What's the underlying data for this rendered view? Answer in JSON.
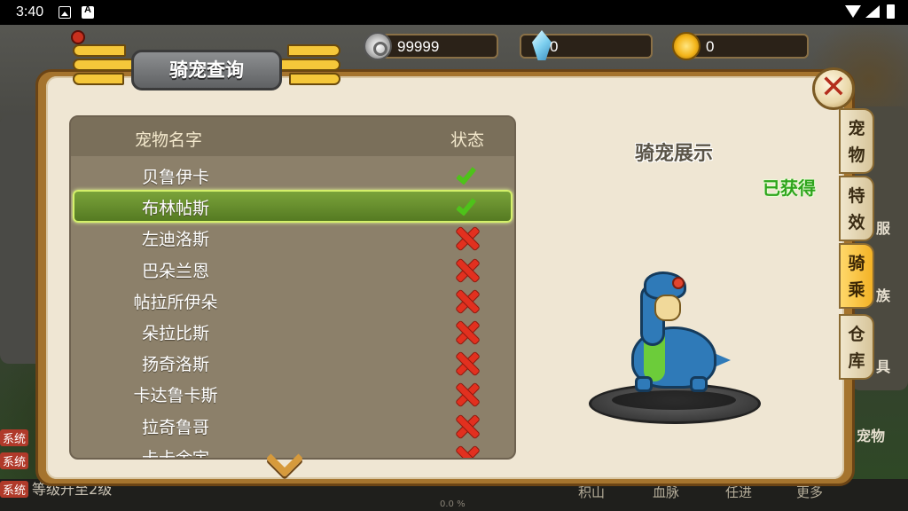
{
  "status_bar": {
    "time": "3:40"
  },
  "currency": {
    "silver": "99999",
    "crystal": "0",
    "gold": "0"
  },
  "panel": {
    "title": "骑宠查询",
    "close_glyph": "✕"
  },
  "pet_list": {
    "header_name": "宠物名字",
    "header_status": "状态",
    "rows": [
      {
        "name": "贝鲁伊卡",
        "status": "obtained"
      },
      {
        "name": "布林帖斯",
        "status": "obtained"
      },
      {
        "name": "左迪洛斯",
        "status": "locked"
      },
      {
        "name": "巴朵兰恩",
        "status": "locked"
      },
      {
        "name": "帖拉所伊朵",
        "status": "locked"
      },
      {
        "name": "朵拉比斯",
        "status": "locked"
      },
      {
        "name": "扬奇洛斯",
        "status": "locked"
      },
      {
        "name": "卡达鲁卡斯",
        "status": "locked"
      },
      {
        "name": "拉奇鲁哥",
        "status": "locked"
      },
      {
        "name": "卡卡余宇",
        "status": "locked"
      }
    ],
    "selected_index": 1
  },
  "display": {
    "title": "骑宠展示",
    "obtained_label": "已获得"
  },
  "side_tabs": [
    {
      "l1": "宠",
      "l2": "物"
    },
    {
      "l1": "特",
      "l2": "效"
    },
    {
      "l1": "骑",
      "l2": "乘"
    },
    {
      "l1": "仓",
      "l2": "库"
    }
  ],
  "background": {
    "chat_tags": [
      "系统",
      "系统",
      "系统"
    ],
    "chat_text": "等级升至2级",
    "menu_items": [
      "积山",
      "血脉",
      "任进",
      "更多"
    ],
    "right_labels": [
      "服",
      "族",
      "具",
      "宠物"
    ],
    "percent": "0.0 %"
  },
  "colors": {
    "frame_brown": "#a5742e",
    "parchment": "#efe6d3",
    "check_green": "#4ec21a",
    "cross_red": "#e2301f",
    "obtained_green": "#2ea41c",
    "active_tab": "#f3b225"
  }
}
